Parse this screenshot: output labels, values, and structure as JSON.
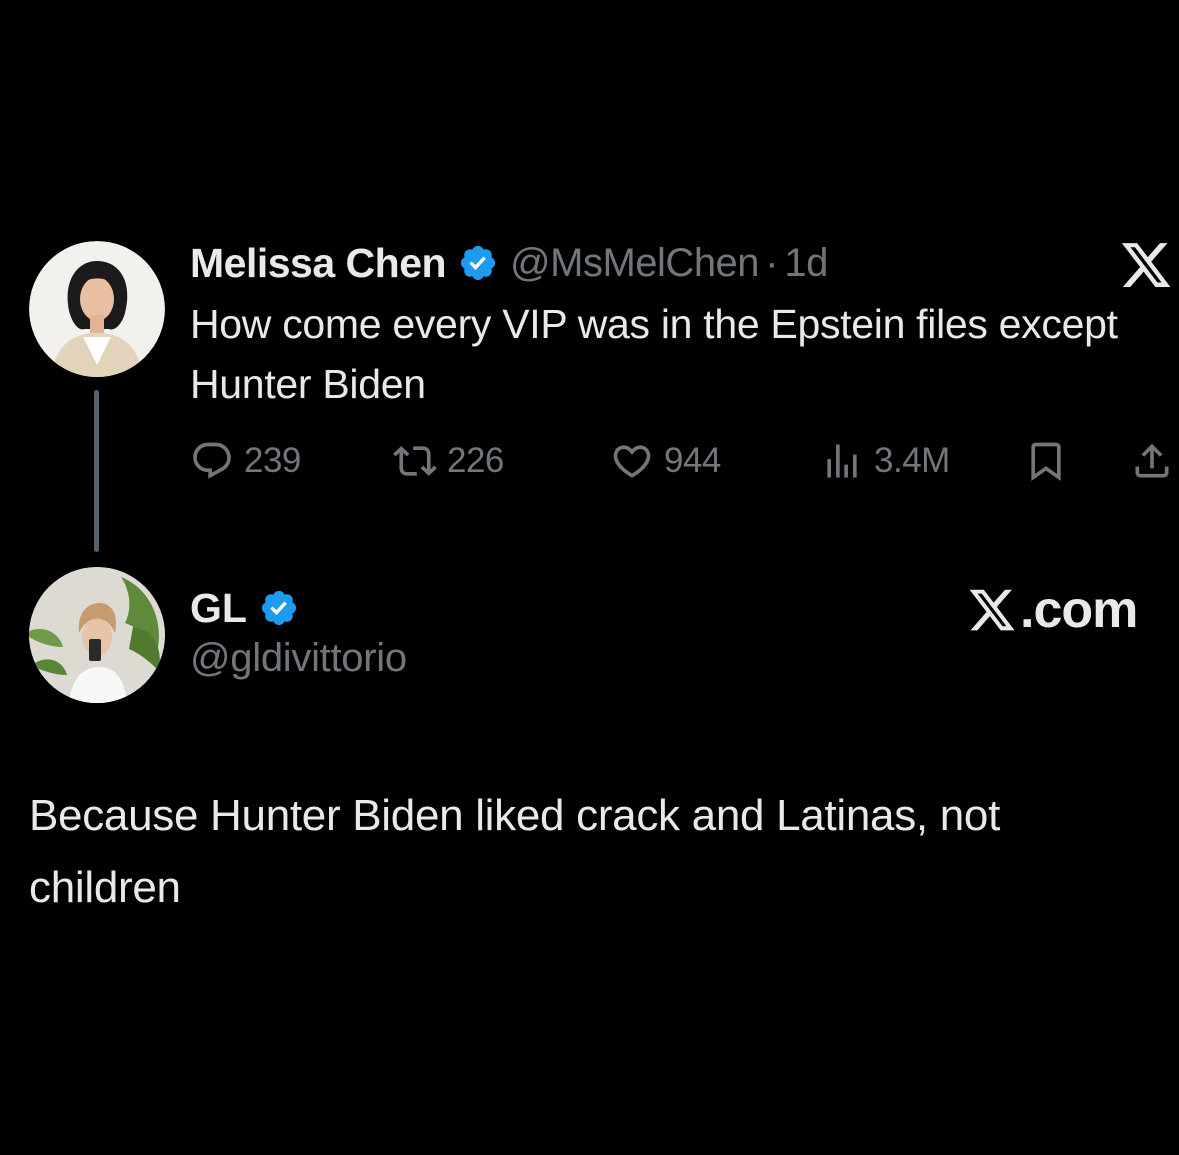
{
  "colors": {
    "background": "#000000",
    "primary_text": "#e7e9ea",
    "secondary_text": "#71767b",
    "verified_badge": "#1d9bf0",
    "thread_line": "#536471"
  },
  "tweet": {
    "author": {
      "display_name": "Melissa Chen",
      "handle": "@MsMelChen",
      "verified": true,
      "avatar_icon": "profile-photo-woman"
    },
    "separator": "·",
    "time": "1d",
    "text": "How come every VIP was in the Epstein files except Hunter Biden",
    "platform_icon": "x-logo-icon",
    "actions": {
      "replies": "239",
      "retweets": "226",
      "likes": "944",
      "views": "3.4M"
    }
  },
  "reply": {
    "author": {
      "display_name": "GL",
      "handle": "@gldivittorio",
      "verified": true,
      "avatar_icon": "profile-photo-mirror-selfie"
    },
    "watermark": ".com",
    "text": "Because Hunter Biden liked crack and Latinas, not children"
  }
}
